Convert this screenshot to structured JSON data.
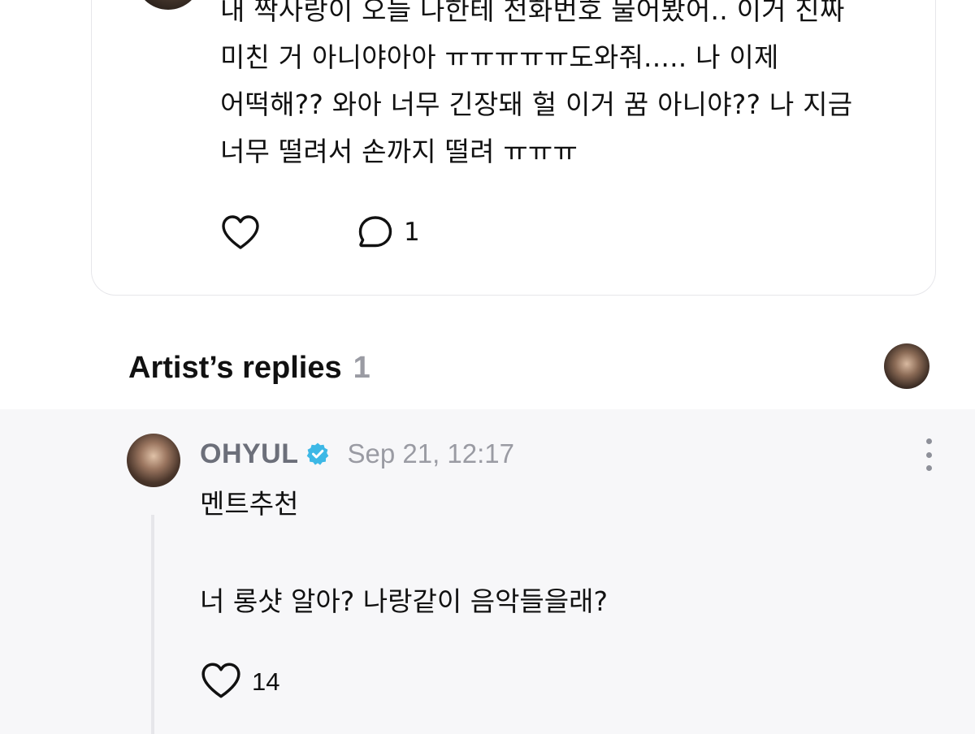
{
  "post": {
    "text": "내 짝사랑이 오늘 나한테 전화번호 물어봤어.. 이거 진짜\n미친 거 아니야아아 ㅠㅠㅠㅠㅠ도와줘..... 나 이제\n어떡해?? 와아 너무 긴장돼 헐 이거 꿈 아니야?? 나 지금\n너무 떨려서 손까지 떨려 ㅠㅠㅠ",
    "comment_count": "1",
    "icons": {
      "like": "heart-icon",
      "comment": "comment-icon"
    }
  },
  "replies_section": {
    "title": "Artist’s replies",
    "count": "1"
  },
  "reply": {
    "author": "OHYUL",
    "verified": true,
    "timestamp": "Sep 21, 12:17",
    "line1": "멘트추천",
    "line2": "너 롱샷 알아? 나랑같이 음악들을래?",
    "like_count": "14",
    "icons": {
      "verified": "verified-badge-icon",
      "more": "more-vertical-icon",
      "like": "heart-icon"
    }
  },
  "colors": {
    "verified_badge": "#3db8e6",
    "muted_text": "#9a9ba3",
    "author_text": "#6c6f7a",
    "reply_background": "#f7f7f9",
    "card_border": "#e6e6ea"
  }
}
